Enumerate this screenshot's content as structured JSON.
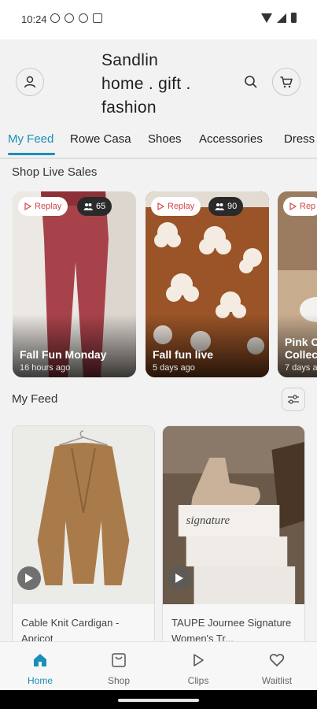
{
  "status_bar": {
    "time": "10:24"
  },
  "header": {
    "store_name_lines": [
      "Sandlin",
      "home . gift .",
      "fashion"
    ]
  },
  "tabs": [
    {
      "label": "My Feed",
      "active": true
    },
    {
      "label": "Rowe Casa"
    },
    {
      "label": "Shoes"
    },
    {
      "label": "Accessories"
    },
    {
      "label": "Dress"
    }
  ],
  "live_sales": {
    "title": "Shop Live Sales",
    "cards": [
      {
        "badge": "Replay",
        "viewers": "65",
        "title": "Fall Fun Monday",
        "time": "16 hours ago"
      },
      {
        "badge": "Replay",
        "viewers": "90",
        "title": "Fall fun live",
        "time": "5 days ago"
      },
      {
        "badge": "Rep",
        "title_lines": [
          "Pink C",
          "Collec"
        ],
        "time": "7 days a"
      }
    ]
  },
  "feed": {
    "title": "My Feed",
    "products": [
      {
        "title": "Cable Knit Cardigan - Apricot"
      },
      {
        "title": "TAUPE Journee Signature Women's Tr..."
      }
    ]
  },
  "bottom_nav": [
    {
      "label": "Home",
      "icon": "home-icon",
      "active": true
    },
    {
      "label": "Shop",
      "icon": "shop-icon"
    },
    {
      "label": "Clips",
      "icon": "play-icon"
    },
    {
      "label": "Waitlist",
      "icon": "heart-icon"
    }
  ],
  "colors": {
    "accent": "#1b8fb8",
    "replay_red": "#d14a4a"
  }
}
